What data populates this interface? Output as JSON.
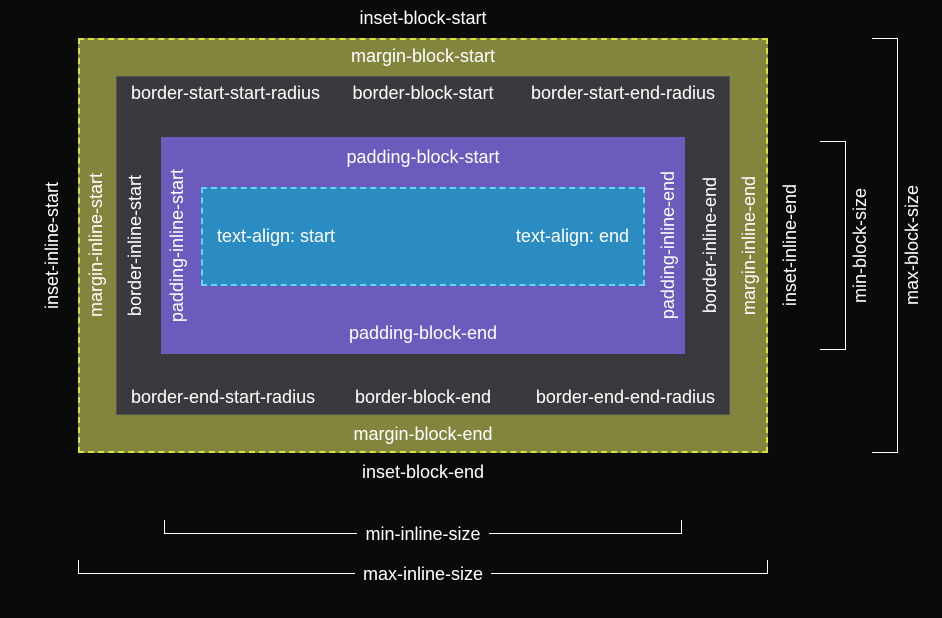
{
  "inset": {
    "block_start": "inset-block-start",
    "block_end": "inset-block-end",
    "inline_start": "inset-inline-start",
    "inline_end": "inset-inline-end"
  },
  "margin": {
    "block_start": "margin-block-start",
    "block_end": "margin-block-end",
    "inline_start": "margin-inline-start",
    "inline_end": "margin-inline-end"
  },
  "border": {
    "block_start": "border-block-start",
    "block_end": "border-block-end",
    "inline_start": "border-inline-start",
    "inline_end": "border-inline-end",
    "radius_ss": "border-start-start-radius",
    "radius_se": "border-start-end-radius",
    "radius_es": "border-end-start-radius",
    "radius_ee": "border-end-end-radius"
  },
  "padding": {
    "block_start": "padding-block-start",
    "block_end": "padding-block-end",
    "inline_start": "padding-inline-start",
    "inline_end": "padding-inline-end"
  },
  "content": {
    "align_start": "text-align: start",
    "align_end": "text-align: end"
  },
  "size": {
    "min_block": "min-block-size",
    "max_block": "max-block-size",
    "min_inline": "min-inline-size",
    "max_inline": "max-inline-size"
  }
}
